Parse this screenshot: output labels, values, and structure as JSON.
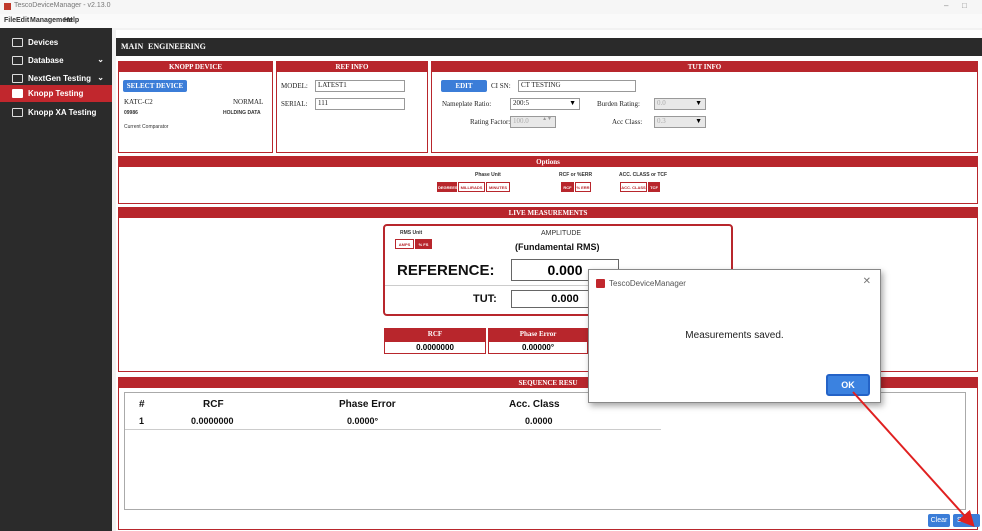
{
  "window": {
    "title": "TescoDeviceManager - v2.13.0",
    "minimize": "–",
    "maximize": "□"
  },
  "menu": [
    "File",
    "Edit",
    "Management",
    "Help"
  ],
  "sidebar": {
    "items": [
      {
        "label": "Devices",
        "icon": "devices-icon",
        "chevron": ""
      },
      {
        "label": "Database",
        "icon": "database-icon",
        "chevron": "⌄"
      },
      {
        "label": "NextGen Testing",
        "icon": "nextgen-icon",
        "chevron": "⌄"
      },
      {
        "label": "Knopp Testing",
        "icon": "knopp-icon",
        "chevron": ""
      },
      {
        "label": "Knopp XA Testing",
        "icon": "knopp-xa-icon",
        "chevron": ""
      }
    ]
  },
  "tabs": [
    "MAIN",
    "ENGINEERING"
  ],
  "knopp": {
    "header": "KNOPP DEVICE",
    "select_btn": "SELECT DEVICE",
    "model": "KATC-C2",
    "mode": "NORMAL",
    "serial": "09986",
    "holding": "HOLDING DATA",
    "type": "Current Comparator"
  },
  "ref": {
    "header": "REF INFO",
    "model_label": "MODEL:",
    "model_value": "LATEST1",
    "serial_label": "SERIAL:",
    "serial_value": "111"
  },
  "tut": {
    "header": "TUT INFO",
    "edit_btn": "EDIT",
    "ci_label": "CI SN:",
    "ci_value": "CT TESTING",
    "nameplate_label": "Nameplate Ratio:",
    "nameplate_value": "200:5",
    "burden_label": "Burden Rating:",
    "burden_value": "0.0",
    "rf_label": "Rating Factor:",
    "rf_value": "100.0",
    "acc_label": "Acc Class:",
    "acc_value": "0.3"
  },
  "options": {
    "header": "Options",
    "phase_label": "Phase Unit",
    "phase_opts": [
      "DEGREES",
      "MILLIRADS",
      "MINUTES"
    ],
    "rcf_label": "RCF or %ERR",
    "rcf_opts": [
      "RCF",
      "% ERR"
    ],
    "acc_label": "ACC. CLASS or TCF",
    "acc_opts": [
      "ACC. CLASS",
      "TCF"
    ]
  },
  "live": {
    "header": "LIVE MEASUREMENTS",
    "rms_label": "RMS Unit",
    "rms_opts": [
      "AMPS",
      "% FS"
    ],
    "amp_label": "AMPLITUDE",
    "amp_sub": "(Fundamental RMS)",
    "ref_label": "REFERENCE:",
    "ref_value": "0.000",
    "tut_label": "TUT:",
    "tut_value": "0.000",
    "rcf_header": "RCF",
    "rcf_value": "0.0000000",
    "pe_header": "Phase Error",
    "pe_value": "0.00000°"
  },
  "sequence": {
    "header": "SEQUENCE RESU",
    "columns": [
      "#",
      "RCF",
      "Phase Error",
      "Acc. Class"
    ],
    "rows": [
      [
        "1",
        "0.0000000",
        "0.0000°",
        "0.0000"
      ]
    ],
    "clear_btn": "Clear",
    "save_btn": "Sa"
  },
  "dialog": {
    "title": "TescoDeviceManager",
    "message": "Measurements saved.",
    "ok": "OK",
    "close": "✕"
  },
  "colors": {
    "accent": "#b8262c",
    "sidebar": "#2b2b2b",
    "button_blue": "#3b7dd8",
    "arrow": "#e02020"
  }
}
